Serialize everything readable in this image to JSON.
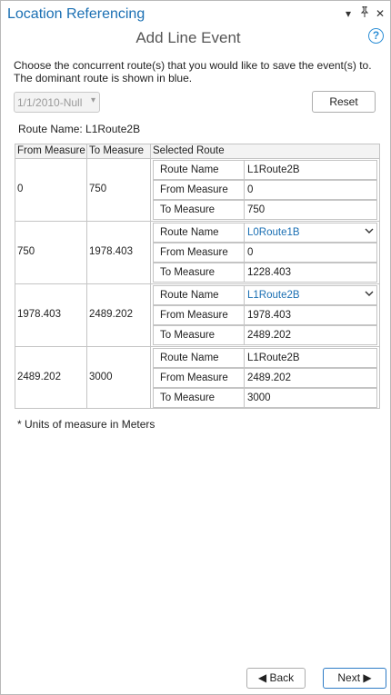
{
  "pane": {
    "title": "Location Referencing",
    "menu_icon": "chevron-down-icon",
    "pin_icon": "pin-icon",
    "close_icon": "close-icon",
    "menu_glyph": "▾",
    "pin_glyph": "ᵖ",
    "close_glyph": "✕"
  },
  "dialog": {
    "title": "Add Line Event",
    "help_glyph": "?",
    "instructions": "Choose the concurrent route(s) that you would like to save the event(s) to. The dominant route is shown in blue."
  },
  "date_select": {
    "value": "1/1/2010-Null"
  },
  "reset_label": "Reset",
  "route_name_text": "Route Name:  L1Route2B",
  "grid": {
    "headers": [
      "From Measure",
      "To Measure",
      "Selected Route"
    ],
    "rows": [
      {
        "from": "0",
        "to": "750",
        "route_name": "L1Route2B",
        "route_from": "0",
        "route_to": "750"
      },
      {
        "from": "750",
        "to": "1978.403",
        "route_name": "L0Route1B",
        "route_from": "0",
        "route_to": "1228.403"
      },
      {
        "from": "1978.403",
        "to": "2489.202",
        "route_name": "L1Route2B",
        "route_from": "1978.403",
        "route_to": "2489.202"
      },
      {
        "from": "2489.202",
        "to": "3000",
        "route_name": "L1Route2B",
        "route_from": "2489.202",
        "route_to": "3000"
      }
    ],
    "sub_labels": {
      "route_name": "Route Name",
      "from_measure": "From Measure",
      "to_measure": "To Measure"
    }
  },
  "units_note": "* Units of measure in Meters",
  "nav": {
    "back_label": "◀ Back",
    "next_label": "Next ▶"
  },
  "colors": {
    "title_blue": "#1a6fb3",
    "dominant_route_blue": "#1a6fb3"
  }
}
